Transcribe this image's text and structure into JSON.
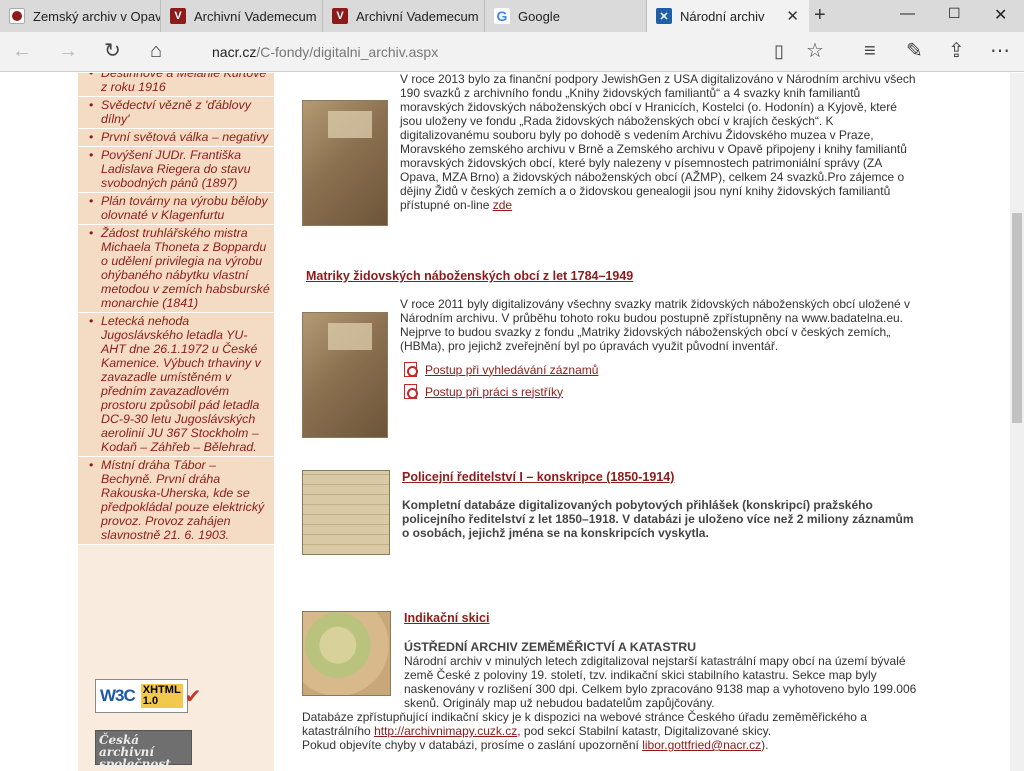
{
  "browser": {
    "tabs": [
      {
        "title": "Zemský archiv v Opav",
        "icon": "archive-favicon-icon",
        "active": false
      },
      {
        "title": "Archivní Vademecum",
        "icon": "vademecum-v-icon",
        "active": false
      },
      {
        "title": "Archivní Vademecum",
        "icon": "vademecum-v-icon",
        "active": false
      },
      {
        "title": "Google",
        "icon": "google-g-icon",
        "active": false
      },
      {
        "title": "Národní archiv",
        "icon": "narodni-archiv-icon",
        "active": true
      }
    ],
    "url_domain": "nacr.cz",
    "url_path": "/C-fondy/digitalni_archiv.aspx"
  },
  "sidebar": {
    "items": [
      "Destinnové a Melanie Kurtové z roku 1916",
      "Svědectví vězně z 'ďáblovy dílny'",
      "První světová válka – negativy",
      "Povýšení JUDr. Františka Ladislava Riegera do stavu svobodných pánů (1897)",
      "Plán továrny na výrobu běloby olovnaté v Klagenfurtu",
      "Žádost truhlářského mistra Michaela Thoneta z Boppardu o udělení privilegia na výrobu ohýbaného nábytku vlastní metodou v zemích habsburské monarchie (1841)",
      "Letecká nehoda Jugoslávského letadla YU-AHT dne 26.1.1972 u České Kamenice. Výbuch trhaviny v zavazadle umístěném v předním zavazadlovém prostoru způsobil pád letadla DC-9-30 letu Jugoslávských aerolinií JU 367 Stockholm – Kodaň – Záhřeb – Bělehrad.",
      "Místní dráha Tábor – Bechyně. První dráha Rakouska-Uherska, kde se předpokládal pouze elektrický provoz. Provoz zahájen slavnostně 21. 6. 1903."
    ],
    "w3c_badge": {
      "w3c": "W3C",
      "xhtml": "XHTML",
      "version": "1.0"
    },
    "cas_badge": "Česká archivní společnost"
  },
  "content": {
    "jewish_families": {
      "text": "V roce 2013 bylo za finanční podpory JewishGen z USA digitalizováno v Národním archivu všech 190 svazků z archivního fondu „Knihy židovských familiantů“ a 4 svazky knih familiantů moravských židovských náboženských obcí v Hranicích, Kostelci (o. Hodonín) a Kyjově, které jsou uloženy ve fondu „Rada židovských náboženských obcí v krajích českých“. K digitalizovanému souboru byly po dohodě s vedením Archivu Židovského muzea v Praze, Moravského zemského archivu v Brně a Zemského archivu v Opavě připojeny i knihy familiantů moravských židovských obcí, které byly nalezeny v písemnostech patrimoniální správy (ZA Opava, MZA Brno) a židovských náboženských obcí (AŽMP), celkem 24 svazků.Pro zájemce o dějiny Židů v českých zemích a o židovskou genealogii jsou nyní knihy židovských familiantů přístupné on-line",
      "link": "zde"
    },
    "matriky": {
      "title": "Matriky židovských náboženských obcí z let 1784–1949",
      "text": "V roce 2011 byly digitalizovány všechny svazky matrik židovských náboženských obcí uložené v Národním archivu. V průběhu tohoto roku budou postupně zpřístupněny na www.badatelna.eu. Nejprve to budou svazky z fondu „Matriky židovských náboženských obcí v českých zemích„ (HBMa), pro jejichž zveřejnění byl po úpravách využit původní inventář.",
      "links": [
        "Postup při vyhledávání záznamů",
        "Postup při práci s rejstříky"
      ]
    },
    "police": {
      "title": "Policejní ředitelství I – konskripce (1850-1914)",
      "text": "Kompletní databáze digitalizovaných pobytových přihlášek (konskripcí) pražského policejního ředitelství z let 1850–1918. V databázi je uloženo více než 2 miliony záznamům o osobách, jejichž jména se na konskripcích vyskytla."
    },
    "maps": {
      "title": "Indikační skici",
      "subtitle": "ÚSTŘEDNÍ ARCHIV ZEMĚMĚŘICTVÍ A KATASTRU",
      "text": "Národní archiv v minulých letech zdigitalizoval nejstarší katastrální mapy obcí na území bývalé země České z poloviny 19. století, tzv. indikační skici stabilního katastru. Sekce map byly naskenovány v rozlišení 300 dpi. Celkem bylo zpracováno 9138 map a vyhotoveno bylo 199.006 skenů. Originály map už nebudou badatelům zapůjčovány.",
      "db_text": "Databáze zpřístupňující indikační skicy je k dispozici na webové stránce Českého úřadu zeměměřického a katastrálního",
      "db_link": "http://archivnimapy.cuzk.cz",
      "db_text2": ", pod sekcí Stabilní katastr, Digitalizované skicy.",
      "error_text": "Pokud objevíte chyby v databázi, prosíme o zaslání upozornění",
      "error_email": "libor.gottfried@nacr.cz",
      "error_end": ")."
    }
  }
}
